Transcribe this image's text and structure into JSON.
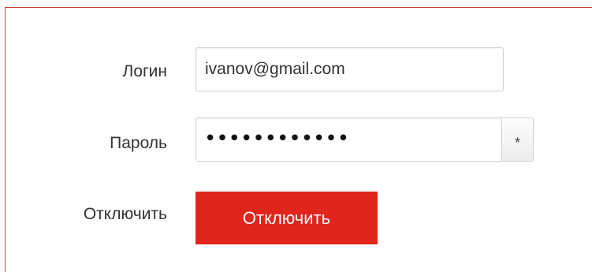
{
  "form": {
    "login_label": "Логин",
    "login_value": "ivanov@gmail.com",
    "password_label": "Пароль",
    "password_masked": "••••••••••••",
    "show_password_icon": "asterisk-icon",
    "show_password_glyph": "*",
    "disable_label": "Отключить",
    "disable_button_label": "Отключить"
  },
  "colors": {
    "accent": "#e0251c",
    "panel_border": "#c8453a",
    "text": "#333333"
  }
}
